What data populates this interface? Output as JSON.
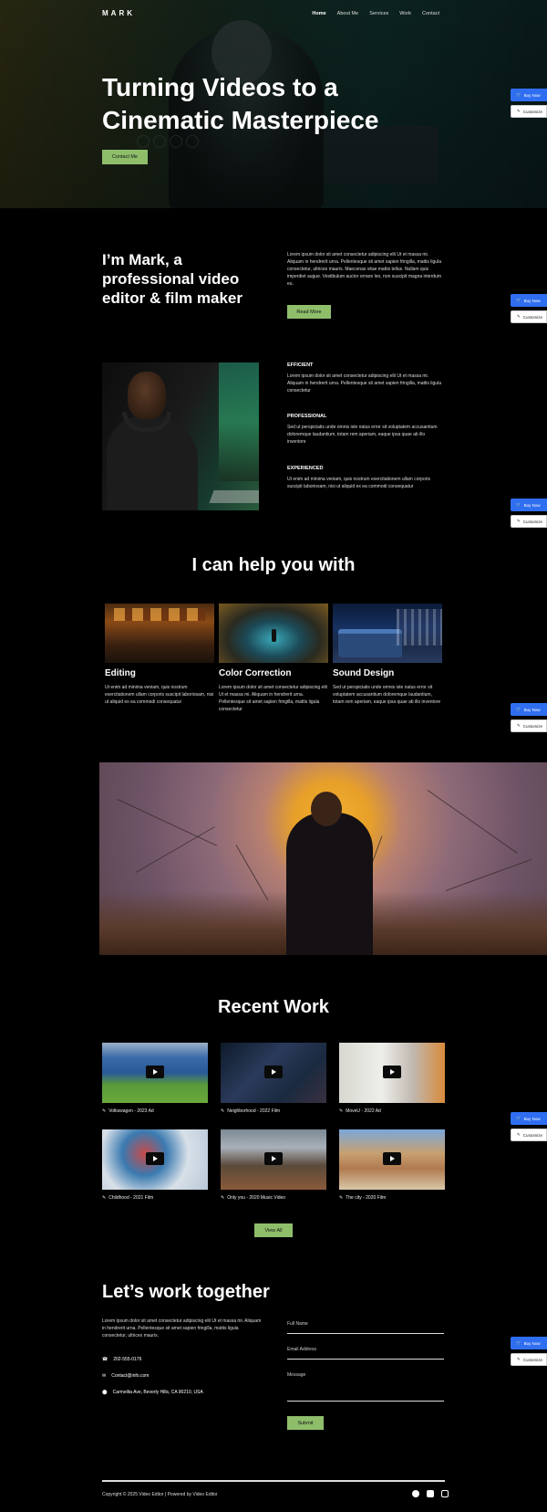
{
  "nav": {
    "logo": "MARK",
    "links": [
      "Home",
      "About Me",
      "Services",
      "Work",
      "Contact"
    ]
  },
  "hero": {
    "title": "Turning Videos to a Cinematic Masterpiece",
    "button": "Contact Me"
  },
  "side_buttons": {
    "buy": "Buy Now",
    "customize": "Customize"
  },
  "about": {
    "title": "I’m Mark, a professional video editor & film maker",
    "text": "Lorem ipsum dolor sit amet consectetur adipiscing elit Ut et massa mi. Aliquam in hendrerit urna. Pellentesque sit amet sapien fringilla, mattis ligula consectetur, ultrices mauris. Maecenas vitae mattis tellus. Nullam quis imperdiet augue. Vestibulum auctor ornare leo, non suscipit magna interdum eu.",
    "button": "Read More"
  },
  "features": [
    {
      "title": "EFFICIENT",
      "text": "Lorem ipsum dolor sit amet consectetur adipiscing elit Ut et massa mi. Aliquam in hendrerit urna. Pellentesque sit amet sapien fringilla, mattis ligula consectetur"
    },
    {
      "title": "PROFESSIONAL",
      "text": "Sed ut perspiciatis unde omnis iste natus error sit voluptatem accusantium doloremque laudantium, totam rem aperiam, eaque ipsa quae ab illo inventore"
    },
    {
      "title": "EXPERIENCED",
      "text": "Ut enim ad minima veniam, quis nostrum exercitationem ullam corporis suscipit laboriosam, nisi ut aliquid ex ea commodi consequatur"
    }
  ],
  "help": {
    "title": "I can help you with",
    "services": [
      {
        "title": "Editing",
        "text": "Ut enim ad minima veniam, quis nostrum exercitationem ullam corporis suscipit laboriosam, nisi ut aliquid ex ea commodi consequatur"
      },
      {
        "title": "Color Correction",
        "text": "Lorem ipsum dolor sit amet consectetur adipiscing elit Ut et massa mi. Aliquam in hendrerit urna. Pellentesque sit amet sapien fringilla, mattis ligula consectetur"
      },
      {
        "title": "Sound Design",
        "text": "Sed ut perspiciatis unde omnis iste natus error sit voluptatem accusantium doloremque laudantium, totam rem aperiam, eaque ipsa quae ab illo inventore"
      }
    ]
  },
  "work": {
    "title": "Recent Work",
    "items": [
      "Volkswagen - 2023 Ad",
      "Neighborhood - 2022 Film",
      "MoveU - 2022 Ad",
      "Childhood - 2021 Film",
      "Only you - 2020 Music Video",
      "The city - 2020 Film"
    ],
    "button": "View All"
  },
  "contact": {
    "title": "Let’s work together",
    "text": "Lorem ipsum dolor sit amet consectetur adipiscing elit Ut et massa mi. Aliquam in hendrerit urna. Pellentesque sit amet sapien fringilla, mattis ligula consectetur, ultrices mauris.",
    "phone": "202-555-0176",
    "email": "Contact@info.com",
    "address": "Carmelita Ave, Beverly Hills, CA 90210, USA",
    "fields": {
      "name": "Full Name",
      "email": "Email Address",
      "message": "Message"
    },
    "submit": "Submit"
  },
  "footer": {
    "copyright": "Copyright © 2025 Video Editor | Powered by Video Editor"
  },
  "colors": {
    "accent_green": "#8fbe6b",
    "buy_blue": "#2f6ef0",
    "background": "#000000"
  }
}
